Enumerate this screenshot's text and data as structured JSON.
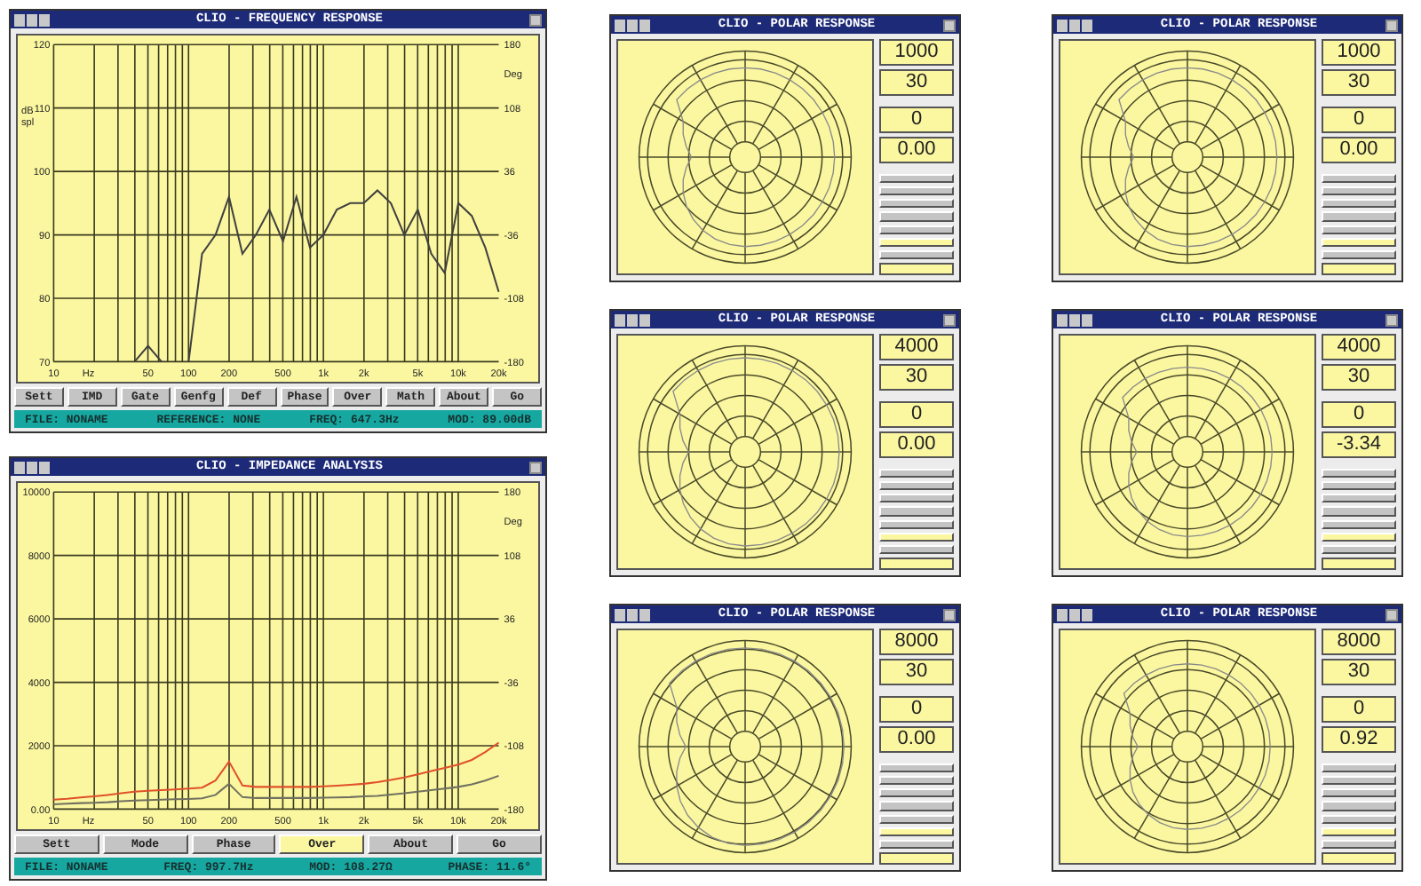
{
  "charts": [
    {
      "title": "CLIO - FREQUENCY RESPONSE",
      "chart_data": {
        "type": "line",
        "xlabel": "Hz",
        "ylabel": "dB spl",
        "grid": true,
        "ylim": [
          70,
          120
        ],
        "categories": [
          "10",
          null,
          null,
          null,
          null,
          null,
          null,
          "50",
          null,
          null,
          "100",
          null,
          null,
          "200",
          null,
          null,
          null,
          "500",
          null,
          null,
          "1k",
          null,
          null,
          "2k",
          null,
          null,
          null,
          "5k",
          null,
          null,
          "10k",
          null,
          null,
          "20k"
        ],
        "yticks": [
          70,
          80,
          90,
          100,
          110,
          120
        ],
        "series": [
          {
            "color": "#404040",
            "values": [
              null,
              null,
              null,
              null,
              null,
              null,
              70,
              72.5,
              70,
              null,
              70,
              87,
              90,
              96,
              87,
              90,
              94,
              89,
              96,
              88,
              90,
              94,
              95,
              95,
              97,
              95,
              90,
              94,
              87,
              84,
              95,
              93,
              88,
              81
            ]
          }
        ]
      },
      "right_axis": {
        "label": "Deg",
        "ticks": [
          "180",
          "108",
          "36",
          "-36",
          "-108",
          "-180"
        ]
      },
      "buttons": [
        {
          "label": "Sett",
          "selected": false
        },
        {
          "label": "IMD",
          "selected": false
        },
        {
          "label": "Gate",
          "selected": false
        },
        {
          "label": "Genfg",
          "selected": false
        },
        {
          "label": "Def",
          "selected": false
        },
        {
          "label": "Phase",
          "selected": false
        },
        {
          "label": "Over",
          "selected": false
        },
        {
          "label": "Math",
          "selected": false
        },
        {
          "label": "About",
          "selected": false
        },
        {
          "label": "Go",
          "selected": false
        }
      ],
      "status": [
        "FILE: NONAME",
        "REFERENCE: NONE",
        "FREQ: 647.3Hz",
        "MOD: 89.00dB"
      ]
    },
    {
      "title": "CLIO - IMPEDANCE ANALYSIS",
      "chart_data": {
        "type": "line",
        "xlabel": "Hz",
        "grid": true,
        "ylim": [
          0,
          10000
        ],
        "categories": [
          "10",
          null,
          null,
          null,
          null,
          null,
          null,
          "50",
          null,
          null,
          "100",
          null,
          null,
          "200",
          null,
          null,
          null,
          "500",
          null,
          null,
          "1k",
          null,
          null,
          "2k",
          null,
          null,
          null,
          "5k",
          null,
          null,
          "10k",
          null,
          null,
          "20k"
        ],
        "yticks": [
          {
            "value": 0,
            "label": "0.00"
          },
          2000,
          4000,
          6000,
          8000,
          10000
        ],
        "series": [
          {
            "color": "#e0502a",
            "values": [
              300,
              330,
              370,
              400,
              450,
              500,
              550,
              580,
              600,
              620,
              650,
              680,
              900,
              1500,
              750,
              700,
              700,
              700,
              700,
              700,
              720,
              740,
              770,
              800,
              850,
              920,
              1000,
              1100,
              1200,
              1300,
              1400,
              1550,
              1800,
              2100
            ]
          },
          {
            "color": "#707060",
            "values": [
              150,
              170,
              190,
              200,
              220,
              250,
              270,
              290,
              300,
              310,
              320,
              340,
              450,
              800,
              380,
              350,
              350,
              350,
              350,
              350,
              360,
              370,
              380,
              400,
              420,
              460,
              500,
              550,
              600,
              650,
              700,
              780,
              900,
              1050
            ]
          }
        ]
      },
      "right_axis": {
        "label": "Deg",
        "ticks": [
          "180",
          "108",
          "36",
          "-36",
          "-108",
          "-180"
        ]
      },
      "buttons": [
        {
          "label": "Sett",
          "selected": false
        },
        {
          "label": "Mode",
          "selected": false
        },
        {
          "label": "Phase",
          "selected": false
        },
        {
          "label": "Over",
          "selected": true
        },
        {
          "label": "About",
          "selected": false
        },
        {
          "label": "Go",
          "selected": false
        }
      ],
      "status": [
        "FILE: NONAME",
        "FREQ: 997.7Hz",
        "MOD: 108.27Ω",
        "PHASE: 11.6°"
      ]
    }
  ],
  "polar_windows": [
    {
      "title": "CLIO - POLAR RESPONSE",
      "values": [
        "1000",
        "30",
        "0",
        "0.00"
      ],
      "buttons": [
        {
          "selected": false
        },
        {
          "selected": false
        },
        {
          "selected": false
        },
        {
          "selected": false
        },
        {
          "selected": false
        },
        {
          "selected": true
        },
        {
          "selected": false
        }
      ]
    },
    {
      "title": "CLIO - POLAR RESPONSE",
      "values": [
        "1000",
        "30",
        "0",
        "0.00"
      ],
      "buttons": [
        {
          "selected": false
        },
        {
          "selected": false
        },
        {
          "selected": false
        },
        {
          "selected": false
        },
        {
          "selected": false
        },
        {
          "selected": true
        },
        {
          "selected": false
        }
      ]
    },
    {
      "title": "CLIO - POLAR RESPONSE",
      "values": [
        "4000",
        "30",
        "0",
        "0.00"
      ],
      "buttons": [
        {
          "selected": false
        },
        {
          "selected": false
        },
        {
          "selected": false
        },
        {
          "selected": false
        },
        {
          "selected": false
        },
        {
          "selected": true
        },
        {
          "selected": false
        }
      ]
    },
    {
      "title": "CLIO - POLAR RESPONSE",
      "values": [
        "4000",
        "30",
        "0",
        "-3.34"
      ],
      "buttons": [
        {
          "selected": false
        },
        {
          "selected": false
        },
        {
          "selected": false
        },
        {
          "selected": false
        },
        {
          "selected": false
        },
        {
          "selected": true
        },
        {
          "selected": false
        }
      ]
    },
    {
      "title": "CLIO - POLAR RESPONSE",
      "values": [
        "8000",
        "30",
        "0",
        "0.00"
      ],
      "buttons": [
        {
          "selected": false
        },
        {
          "selected": false
        },
        {
          "selected": false
        },
        {
          "selected": false
        },
        {
          "selected": false
        },
        {
          "selected": true
        },
        {
          "selected": false
        }
      ]
    },
    {
      "title": "CLIO - POLAR RESPONSE",
      "values": [
        "8000",
        "30",
        "0",
        "0.92"
      ],
      "buttons": [
        {
          "selected": false
        },
        {
          "selected": false
        },
        {
          "selected": false
        },
        {
          "selected": false
        },
        {
          "selected": false
        },
        {
          "selected": true
        },
        {
          "selected": false
        }
      ]
    }
  ]
}
